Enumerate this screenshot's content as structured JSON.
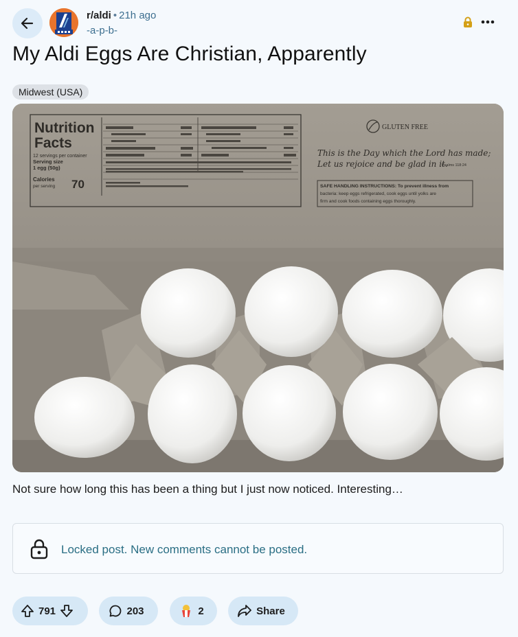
{
  "header": {
    "subreddit": "r/aldi",
    "separator": "•",
    "time_ago": "21h ago",
    "username": "-a-p-b-",
    "more_label": "•••"
  },
  "post": {
    "title": "My Aldi Eggs Are Christian, Apparently",
    "flair": "Midwest (USA)",
    "body": "Not sure how long this has been a thing but I just now noticed. Interesting…"
  },
  "image": {
    "nutrition_title_1": "Nutrition",
    "nutrition_title_2": "Facts",
    "servings": "12 servings per container",
    "serving_size": "Serving size",
    "serving_value": "1 egg (50g)",
    "calories_label": "Calories",
    "calories_per": "per serving",
    "calories": "70",
    "gluten_free": "GLUTEN FREE",
    "verse_1": "This is the Day which the Lord has made;",
    "verse_2": "Let us rejoice and be glad in it.",
    "verse_ref": "Psalms 118:24",
    "safe_1": "SAFE HANDLING INSTRUCTIONS: To prevent illness from",
    "safe_2": "bacteria: keep eggs refrigerated, cook eggs until yolks are",
    "safe_3": "firm and cook foods containing eggs thoroughly."
  },
  "locked": {
    "message": "Locked post. New comments cannot be posted."
  },
  "actions": {
    "votes": "791",
    "comments": "203",
    "awards": "2",
    "share_label": "Share"
  }
}
